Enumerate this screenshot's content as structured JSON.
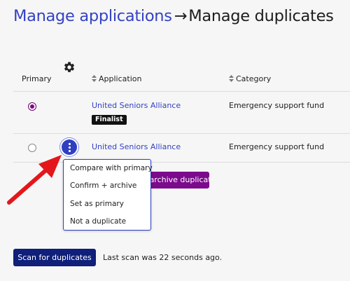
{
  "page": {
    "breadcrumb_link": "Manage applications",
    "breadcrumb_arrow": "→",
    "title": "Manage duplicates"
  },
  "table": {
    "columns": {
      "primary": "Primary",
      "settings_icon": "gear-icon",
      "application": "Application",
      "category": "Category"
    },
    "rows": [
      {
        "primary_selected": true,
        "application": "United Seniors Alliance",
        "badge": "Finalist",
        "category": "Emergency support fund"
      },
      {
        "primary_selected": false,
        "application": "United Seniors Alliance",
        "badge": "",
        "category": "Emergency support fund"
      }
    ]
  },
  "actions": {
    "archive_button": "Confirm + archive duplicates"
  },
  "row_menu": {
    "icon": "kebab-vertical-icon",
    "items": [
      "Compare with primary",
      "Confirm + archive",
      "Set as primary",
      "Not a duplicate"
    ]
  },
  "scan": {
    "button": "Scan for duplicates",
    "status": "Last scan was 22 seconds ago."
  },
  "colors": {
    "link": "#3442c4",
    "primary_button": "#0f1f7a",
    "archive_button": "#7c0a8c",
    "radio_selected": "#7b0a7b",
    "annotation_arrow": "#e4161b"
  }
}
